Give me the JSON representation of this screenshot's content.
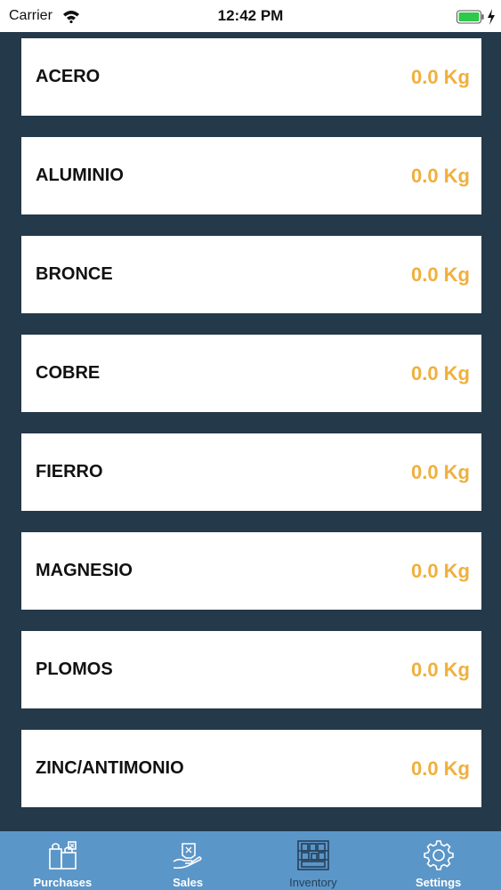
{
  "status_bar": {
    "carrier": "Carrier",
    "time": "12:42 PM",
    "icons": [
      "wifi-icon",
      "battery-icon",
      "charging-bolt-icon"
    ]
  },
  "inventory": {
    "items": [
      {
        "name": "ACERO",
        "weight": "0.0 Kg"
      },
      {
        "name": "ALUMINIO",
        "weight": "0.0 Kg"
      },
      {
        "name": "BRONCE",
        "weight": "0.0 Kg"
      },
      {
        "name": "COBRE",
        "weight": "0.0 Kg"
      },
      {
        "name": "FIERRO",
        "weight": "0.0 Kg"
      },
      {
        "name": "MAGNESIO",
        "weight": "0.0 Kg"
      },
      {
        "name": "PLOMOS",
        "weight": "0.0 Kg"
      },
      {
        "name": "ZINC/ANTIMONIO",
        "weight": "0.0 Kg"
      }
    ]
  },
  "tab_bar": {
    "tabs": [
      {
        "label": "Purchases",
        "icon": "shopping-bags-icon"
      },
      {
        "label": "Sales",
        "icon": "hand-package-icon"
      },
      {
        "label": "Inventory",
        "icon": "warehouse-shelves-icon",
        "active": true
      },
      {
        "label": "Settings",
        "icon": "gear-icon"
      }
    ]
  },
  "colors": {
    "background": "#24394a",
    "row_background": "#ffffff",
    "weight_text": "#f0b03c",
    "tab_bar": "#5b96c8",
    "active_tab": "#26405a"
  }
}
